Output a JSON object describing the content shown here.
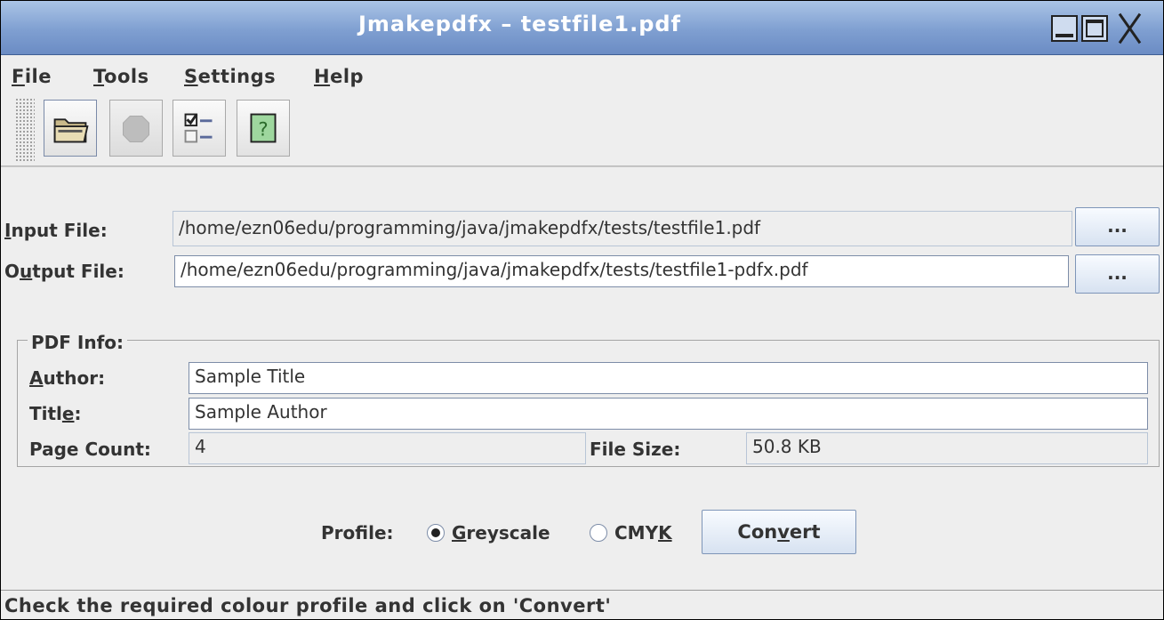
{
  "window": {
    "title": "Jmakepdfx – testfile1.pdf"
  },
  "menu": [
    {
      "label": "File",
      "mnemonic": "F",
      "rest": "ile"
    },
    {
      "label": "Tools",
      "mnemonic": "T",
      "rest": "ools"
    },
    {
      "label": "Settings",
      "mnemonic": "S",
      "rest": "ettings"
    },
    {
      "label": "Help",
      "mnemonic": "H",
      "rest": "elp"
    }
  ],
  "toolbar": {
    "buttons": [
      {
        "icon": "open-folder-icon"
      },
      {
        "icon": "stop-icon",
        "disabled": true
      },
      {
        "icon": "checklist-icon"
      },
      {
        "icon": "help-icon"
      }
    ]
  },
  "files": {
    "input_label_mn": "I",
    "input_label_rest": "nput File:",
    "input_value": "/home/ezn06edu/programming/java/jmakepdfx/tests/testfile1.pdf",
    "output_label_a": "O",
    "output_label_mn": "u",
    "output_label_rest": "tput File:",
    "output_value": "/home/ezn06edu/programming/java/jmakepdfx/tests/testfile1-pdfx.pdf",
    "browse_label": "..."
  },
  "pdf_info": {
    "group_title": "PDF Info:",
    "author_mn": "A",
    "author_rest": "uthor:",
    "author_value": "Sample Title",
    "title_a": "Titl",
    "title_mn": "e",
    "title_rest": ":",
    "title_value": "Sample Author",
    "page_count_label": "Page Count:",
    "page_count_value": "4",
    "file_size_label": "File Size:",
    "file_size_value": "50.8 KB"
  },
  "profile": {
    "label": "Profile:",
    "greyscale_mn": "G",
    "greyscale_rest": "reyscale",
    "cmyk_a": "CMY",
    "cmyk_mn": "K",
    "selected": "Greyscale",
    "convert_a": "Con",
    "convert_mn": "v",
    "convert_rest": "ert"
  },
  "status": {
    "text": "Check the required colour profile and click on 'Convert'"
  },
  "colors": {
    "titlebar": "#7f9fd1",
    "background": "#eeeeee",
    "button_gradient_bottom": "#d7e2f1"
  }
}
